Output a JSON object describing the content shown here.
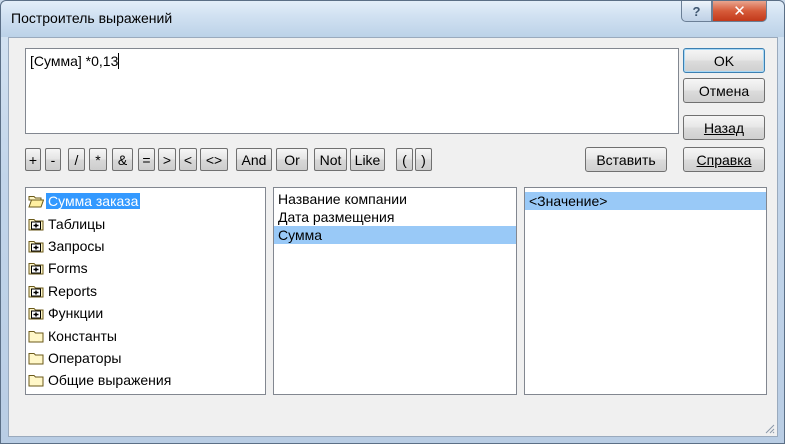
{
  "window": {
    "title": "Построитель выражений",
    "help_glyph": "?",
    "close_glyph": "✕"
  },
  "expression": {
    "value": "[Сумма] *0,13"
  },
  "buttons": {
    "ok": "OK",
    "cancel": "Отмена",
    "back": "Назад",
    "insert": "Вставить",
    "help": "Справка"
  },
  "operators": [
    "+",
    "-",
    "/",
    "*",
    "&",
    "=",
    ">",
    "<",
    "<>",
    "And",
    "Or",
    "Not",
    "Like",
    "(",
    ")"
  ],
  "tree": {
    "items": [
      {
        "label": "Сумма заказа",
        "icon": "open-folder-icon",
        "selected": true
      },
      {
        "label": "Таблицы",
        "icon": "expand-folder-icon"
      },
      {
        "label": "Запросы",
        "icon": "expand-folder-icon"
      },
      {
        "label": "Forms",
        "icon": "expand-folder-icon"
      },
      {
        "label": "Reports",
        "icon": "expand-folder-icon"
      },
      {
        "label": "Функции",
        "icon": "expand-folder-icon"
      },
      {
        "label": "Константы",
        "icon": "folder-icon"
      },
      {
        "label": "Операторы",
        "icon": "folder-icon"
      },
      {
        "label": "Общие выражения",
        "icon": "folder-icon"
      }
    ]
  },
  "fields": {
    "items": [
      "Название компании",
      "Дата размещения",
      "Сумма"
    ],
    "selected": "Сумма"
  },
  "values": {
    "items": [
      "<Значение>"
    ],
    "selected": "<Значение>"
  },
  "colors": {
    "selection": "#3399ff",
    "list_selection": "#99c9f7"
  }
}
